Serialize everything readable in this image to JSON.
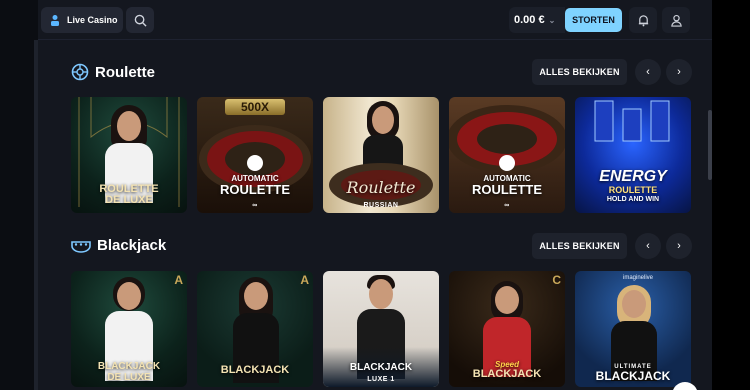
{
  "topbar": {
    "live_casino_label": "Live Casino",
    "balance": "0.00 €",
    "deposit_label": "STORTEN"
  },
  "sections": [
    {
      "title": "Roulette",
      "view_all": "ALLES BEKIJKEN",
      "tiles": [
        {
          "name": "roulette-de-luxe",
          "line1": "ROULETTE",
          "line2": "DE LUXE"
        },
        {
          "name": "500x-automatic-roulette",
          "badge": "500X",
          "line1": "AUTOMATIC",
          "line2": "ROULETTE"
        },
        {
          "name": "russian-roulette",
          "line1": "Roulette",
          "line2": "RUSSIAN"
        },
        {
          "name": "automatic-roulette",
          "line1": "AUTOMATIC",
          "line2": "ROULETTE"
        },
        {
          "name": "energy-roulette",
          "line1": "ENERGY",
          "line2": "ROULETTE",
          "line3": "HOLD AND WIN"
        }
      ]
    },
    {
      "title": "Blackjack",
      "view_all": "ALLES BEKIJKEN",
      "tiles": [
        {
          "name": "blackjack-de-luxe",
          "corner": "A",
          "line1": "BLACKJACK",
          "line2": "DE LUXE"
        },
        {
          "name": "blackjack-a",
          "corner": "A",
          "line1": "BLACKJACK"
        },
        {
          "name": "blackjack-luxe-1",
          "line1": "BLACKJACK",
          "line2": "LUXE 1"
        },
        {
          "name": "speed-blackjack-c",
          "corner": "C",
          "line0": "Speed",
          "line1": "BLACKJACK"
        },
        {
          "name": "ultimate-blackjack",
          "top": "imaginelive",
          "line0": "ULTIMATE",
          "line1": "BLACKJACK"
        }
      ]
    }
  ],
  "colors": {
    "accent": "#7fd3ff",
    "background": "#14171f",
    "button": "#1e222c"
  }
}
